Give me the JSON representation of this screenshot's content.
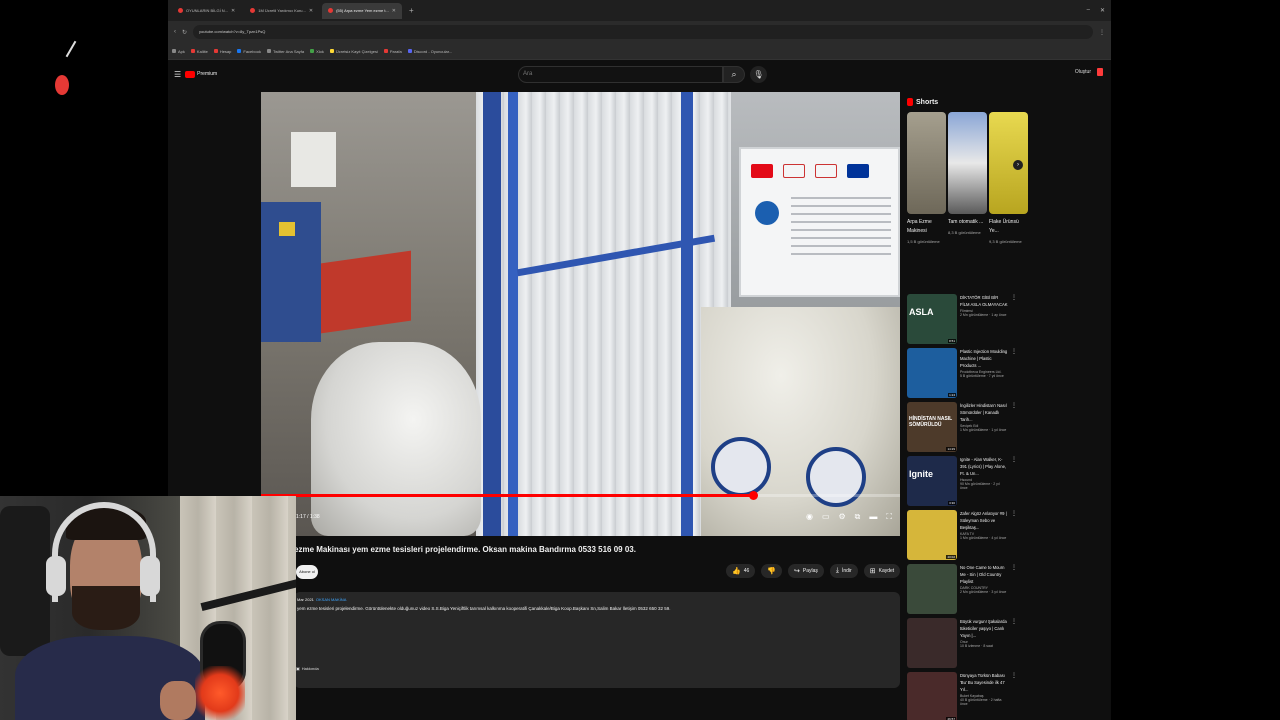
{
  "browser": {
    "tabs": [
      {
        "label": "OYUNLARIN BİLGİ N..."
      },
      {
        "label": "1M Ücretli Yardımcı Kuru..."
      },
      {
        "label": "(55) Arpa ezme Yem ezme t..."
      }
    ],
    "url": "youtube.com/watch?v=8y_Tpzn1PsQ",
    "bookmarks": [
      "Apk",
      "Kaliite",
      "Hesap",
      "Facebook",
      "Twitter Ana Sayfa",
      "Xlok",
      "Ücretsiz Kayıt Çizelgesi",
      "Parafa",
      "Discord - Oyuncular..."
    ]
  },
  "youtube": {
    "logo_text": "Premium",
    "search_placeholder": "Ara",
    "create_label": "Oluştur"
  },
  "player": {
    "time": "1:17 / 1:38",
    "progress_fraction": 0.77
  },
  "video": {
    "title": "ezme Makinası yem ezme tesisleri projelendirme. Oksan makina Bandırma 0533 516 09 03.",
    "subscribe_label": "Abone ol",
    "likes": "46",
    "share_label": "Paylaş",
    "download_label": "İndir",
    "save_label": "Kaydet",
    "description_meta": "Mar 2021",
    "channel_name": "OKSAN MAKİNA",
    "description_text": "yem ezme tesisleri projelendirme. Görüntülenekte olduğunuz video S.S.Biga Yeniçiftlik tarımsal kalkınma kooperatifi Çanakkale/Biga Koop.Başkanı Sn,Salim Bakar İletişim 0532 650 32 59.",
    "about_label": "Hakkında"
  },
  "sidebar": {
    "shorts_heading": "Shorts",
    "shorts": [
      {
        "title": "Arpa Ezme Makinesi",
        "views": "1,5 B görüntüleme",
        "color": "#8f8a7a"
      },
      {
        "title": "Tam otomatik ...",
        "views": "8,3 B görüntüleme",
        "color": "#5f7fb5"
      },
      {
        "title": "Flake Ürünsü Ye...",
        "views": "9,3 B görüntüleme",
        "color": "#d6c63a"
      }
    ],
    "recommendations": [
      {
        "title": "DİKTATÖR GİBİ BİR FİLM ASLA OLMAYACAK",
        "channel": "Flimimsi",
        "views": "2 Mn görüntüleme · 1 ay önce",
        "duration": "8:51",
        "overlay": "ASLA",
        "color": "#2a4a3a"
      },
      {
        "title": "Plastic Injection Moulding Machine | Plastic Products ...",
        "channel": "Prodotheca Engineers Ltd.",
        "views": "5 B görüntüleme · 7 yıl önce",
        "duration": "1:24",
        "overlay": "",
        "color": "#1d5e9e"
      },
      {
        "title": "İngilizler Hindistan'ı Nasıl Sömürdüler | Kanadlı Tarih...",
        "channel": "Seviçek Edi",
        "views": "1 Mn görüntüleme · 1 yıl önce",
        "duration": "14:29",
        "overlay": "HİNDİSTAN NASIL SÖMÜRÜLDÜ",
        "color": "#4d3a2a"
      },
      {
        "title": "Ignite - Alan Walker, K-391 (Lyrics) | Play Alone, Ft. & Un...",
        "channel": "Hsound",
        "views": "90 Mn görüntüleme · 2 yıl önce",
        "duration": "3:30",
        "overlay": "Ignite",
        "color": "#1e2a4a"
      },
      {
        "title": "Zafer Algöz Anlatıyor #9 | Süleyman Sebo ve Beşiktaş...",
        "channel": "KAFA TV",
        "views": "1 Mn görüntüleme · 4 yıl önce",
        "duration": "20:02",
        "overlay": "",
        "color": "#d6b63a"
      },
      {
        "title": "No One Came to Mourn Me - Sin | Old Country Playlist",
        "channel": "DARK COUNTRY",
        "views": "2 Mn görüntüleme · 3 yıl önce",
        "duration": "",
        "overlay": "",
        "color": "#3a4a3a"
      },
      {
        "title": "Büyük vurgun! Şakalarda tüketiciler yaşıyo | Canlı Yayın |...",
        "channel": "Onur",
        "views": "10 B izlenme · 8 saat",
        "duration": "",
        "overlay": "",
        "color": "#3a2a2a"
      },
      {
        "title": "Dünyaya Türkün Babası 'Bu' Bu Sayesinde ilk 47 Yıl...",
        "channel": "Buket Kayabaş",
        "views": "40 B görüntüleme · 2 hafta önce",
        "duration": "26:57",
        "overlay": "",
        "color": "#4a2a2a"
      }
    ]
  }
}
